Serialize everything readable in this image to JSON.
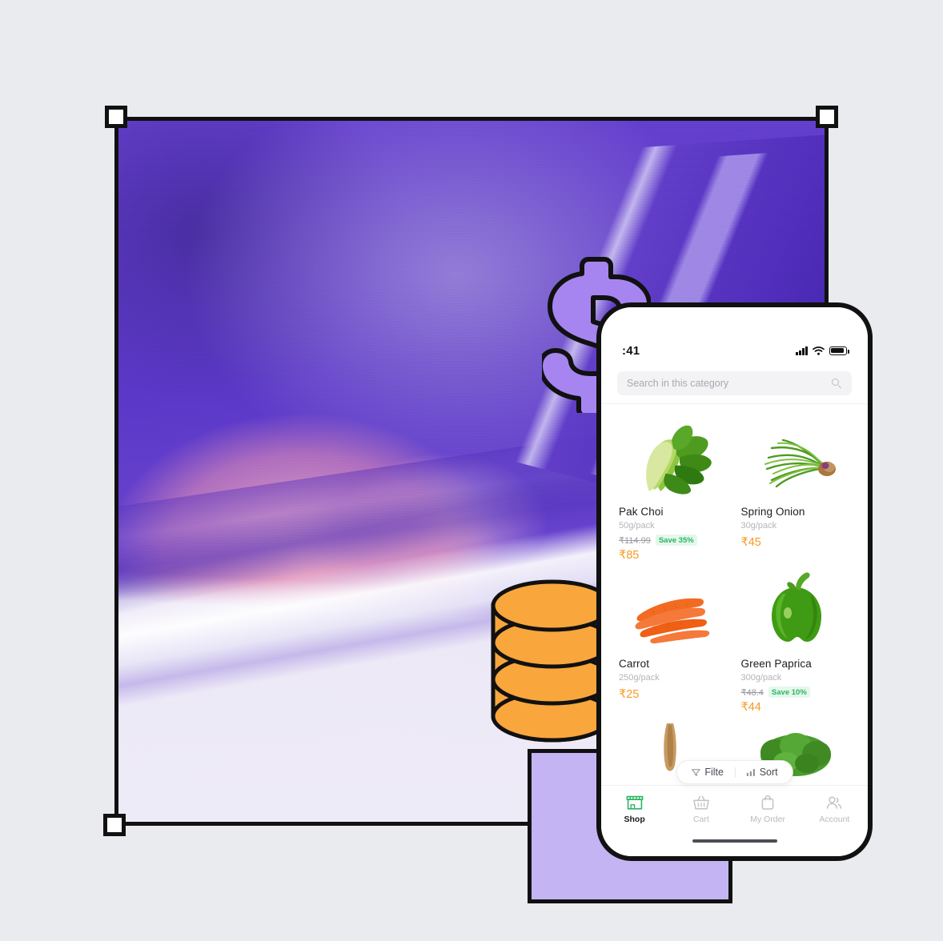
{
  "canvas": {
    "background_color": "#eaebef",
    "selection_frame": {
      "label": "image-placeholder-selection",
      "outline_color": "#111111",
      "fill_color": "#5b39c4",
      "handles": [
        "top-left",
        "top-right",
        "bottom-left"
      ]
    },
    "accent_block_color": "#c4b4f3",
    "dollar_icon": {
      "name": "dollar-sign-icon",
      "fill": "#a685f0",
      "stroke": "#111111"
    },
    "coin_stack_icon": {
      "name": "coin-stack-icon",
      "fill": "#f9a63c",
      "stroke": "#111111",
      "coins": 3
    }
  },
  "phone": {
    "status_bar": {
      "time": ":41",
      "signal_icon": "cellular-signal-icon",
      "wifi_icon": "wifi-icon",
      "battery_icon": "battery-icon"
    },
    "search": {
      "placeholder": "Search in this category",
      "value": "",
      "icon": "search-icon"
    },
    "products": [
      {
        "image": "pak-choi",
        "name": "Pak Choi",
        "weight": "50g/pack",
        "old_price": "₹114.99",
        "save_badge": "Save 35%",
        "price": "₹85"
      },
      {
        "image": "spring-onion",
        "name": "Spring Onion",
        "weight": "30g/pack",
        "old_price": "",
        "save_badge": "",
        "price": "₹45"
      },
      {
        "image": "carrot",
        "name": "Carrot",
        "weight": "250g/pack",
        "old_price": "",
        "save_badge": "",
        "price": "₹25"
      },
      {
        "image": "green-paprica",
        "name": "Green Paprica",
        "weight": "300g/pack",
        "old_price": "₹48.4",
        "save_badge": "Save 10%",
        "price": "₹44"
      },
      {
        "image": "burdock-root",
        "name": "",
        "weight": "",
        "old_price": "",
        "save_badge": "",
        "price": ""
      },
      {
        "image": "broccoli",
        "name": "",
        "weight": "",
        "old_price": "",
        "save_badge": "",
        "price": ""
      }
    ],
    "filter_sort": {
      "filter_label": "Filte",
      "filter_icon": "funnel-icon",
      "sort_label": "Sort",
      "sort_icon": "sort-bars-icon"
    },
    "tabbar": {
      "items": [
        {
          "label": "Shop",
          "icon": "store-icon",
          "active": true,
          "color": "#2bb463"
        },
        {
          "label": "Cart",
          "icon": "basket-icon",
          "active": false,
          "color": "#c2c2c8"
        },
        {
          "label": "My Order",
          "icon": "bag-icon",
          "active": false,
          "color": "#c2c2c8"
        },
        {
          "label": "Account",
          "icon": "people-icon",
          "active": false,
          "color": "#c2c2c8"
        }
      ]
    },
    "accent_price_color": "#f79a25",
    "accent_save_color": "#2bb463"
  }
}
